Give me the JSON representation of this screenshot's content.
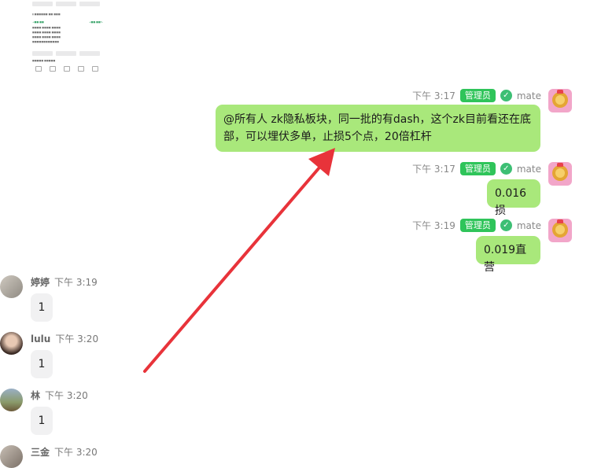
{
  "messages_out": [
    {
      "time": "下午 3:17",
      "role": "管理员",
      "user": "mate",
      "text": "@所有人 zk隐私板块，同一批的有dash，这个zk目前看还在底部，可以埋伏多单，止损5个点，20倍杠杆"
    },
    {
      "time": "下午 3:17",
      "role": "管理员",
      "user": "mate",
      "text": "0.016损"
    },
    {
      "time": "下午 3:19",
      "role": "管理员",
      "user": "mate",
      "text": "0.019直营"
    }
  ],
  "messages_in": [
    {
      "name": "婷婷",
      "time": "下午 3:19",
      "text": "1"
    },
    {
      "name": "lulu",
      "time": "下午 3:20",
      "text": "1"
    },
    {
      "name": "林",
      "time": "下午 3:20",
      "text": "1"
    },
    {
      "name": "三金",
      "time": "下午 3:20",
      "text": ""
    }
  ],
  "colors": {
    "bubble_out": "#a9e87b",
    "badge": "#2fc45a",
    "bubble_in": "#f1f1f2",
    "arrow": "#e8333a"
  }
}
